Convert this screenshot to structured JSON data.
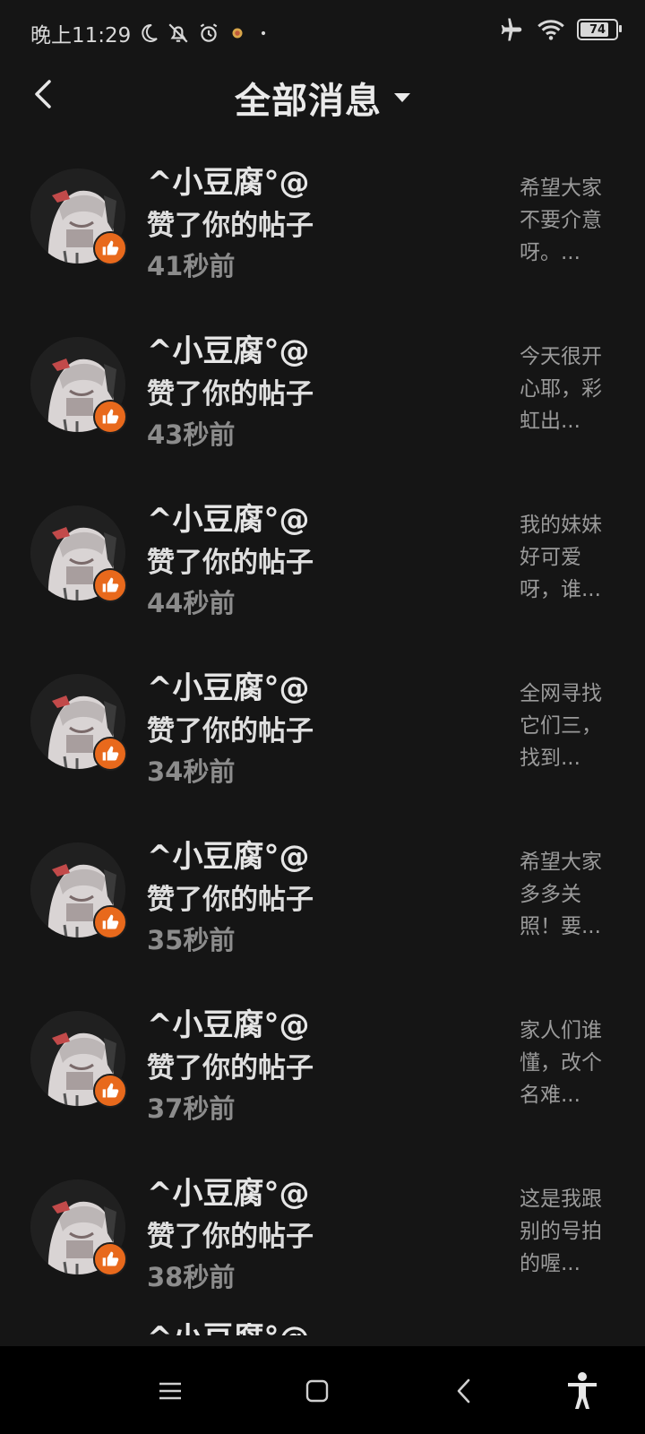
{
  "status_bar": {
    "time": "晚上11:29",
    "battery": "74",
    "icons": [
      "moon-icon",
      "bell-off-icon",
      "alarm-icon",
      "app-dot-icon",
      "airplane-icon",
      "wifi-icon",
      "battery-icon"
    ]
  },
  "header": {
    "title": "全部消息",
    "back_icon": "chevron-left-icon",
    "dropdown_icon": "triangle-down-icon"
  },
  "messages": [
    {
      "name": "^小豆腐°@",
      "action": "赞了你的帖子",
      "time": "41秒前",
      "preview": "希望大家\n不要介意\n呀。..."
    },
    {
      "name": "^小豆腐°@",
      "action": "赞了你的帖子",
      "time": "43秒前",
      "preview": "今天很开\n心耶，彩\n虹出..."
    },
    {
      "name": "^小豆腐°@",
      "action": "赞了你的帖子",
      "time": "44秒前",
      "preview": "我的妹妹\n好可爱\n呀，谁..."
    },
    {
      "name": "^小豆腐°@",
      "action": "赞了你的帖子",
      "time": "34秒前",
      "preview": "全网寻找\n它们三，\n找到..."
    },
    {
      "name": "^小豆腐°@",
      "action": "赞了你的帖子",
      "time": "35秒前",
      "preview": "希望大家\n多多关\n照！要..."
    },
    {
      "name": "^小豆腐°@",
      "action": "赞了你的帖子",
      "time": "37秒前",
      "preview": "家人们谁\n懂，改个\n名难..."
    },
    {
      "name": "^小豆腐°@",
      "action": "赞了你的帖子",
      "time": "38秒前",
      "preview": "这是我跟\n别的号拍\n的喔..."
    }
  ],
  "peek_name": "^小豆腐°@",
  "nav_bar": {
    "icons": [
      "menu-icon",
      "home-square-icon",
      "back-icon",
      "accessibility-icon"
    ]
  },
  "colors": {
    "background": "#151515",
    "like_badge": "#e8691c",
    "navbar": "#000000"
  }
}
